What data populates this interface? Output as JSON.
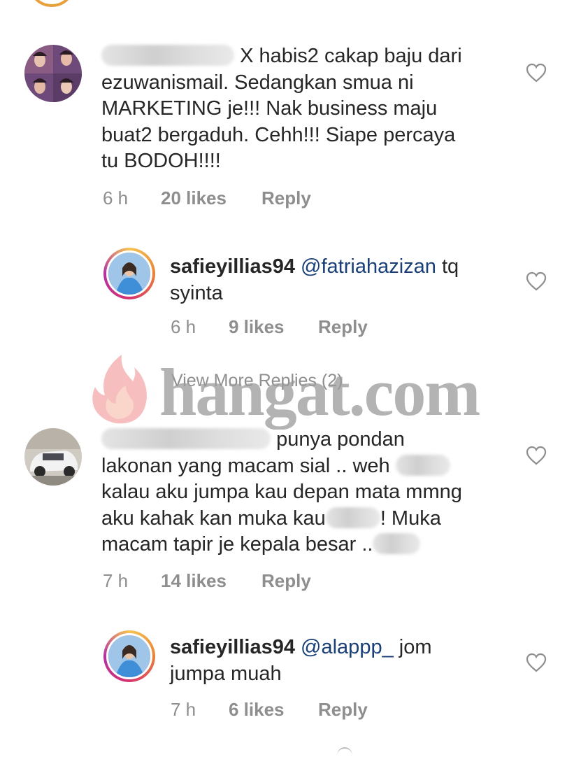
{
  "comments": [
    {
      "lines": [
        "X habis2 cakap baju dari",
        "ezuwanismail. Sedangkan smua ni",
        "MARKETING je!!! Nak business maju",
        "buat2 bergaduh. Cehh!!! Siape percaya",
        "tu BODOH!!!!"
      ],
      "time": "6 h",
      "likes": "20 likes",
      "reply": "Reply"
    },
    {
      "username": "safieyillias94",
      "mention": "@fatriahazizan",
      "text1": "tq",
      "text2": "syinta",
      "time": "6 h",
      "likes": "9 likes",
      "reply": "Reply"
    },
    {
      "view_more": "View More Replies (2)"
    },
    {
      "lines": [
        "punya pondan",
        "lakonan yang macam sial .. weh",
        "kalau aku jumpa kau depan mata mmng",
        "aku kahak kan muka kau",
        "! Muka",
        "macam tapir je kepala besar .."
      ],
      "time": "7 h",
      "likes": "14 likes",
      "reply": "Reply"
    },
    {
      "username": "safieyillias94",
      "mention": "@alappp_",
      "text1": "jom",
      "text2": "jumpa muah",
      "time": "7 h",
      "likes": "6 likes",
      "reply": "Reply"
    }
  ],
  "watermark": {
    "text": "hangat.com",
    "colors": {
      "flame_outer": "#f08a8a",
      "flame_inner": "#f7b3a0",
      "text": "#9a9a9a"
    }
  },
  "icons": {
    "heart": "heart-icon",
    "avatar_story_ring": [
      "#f6c452",
      "#e8823a",
      "#d6336c",
      "#b530a6"
    ]
  }
}
